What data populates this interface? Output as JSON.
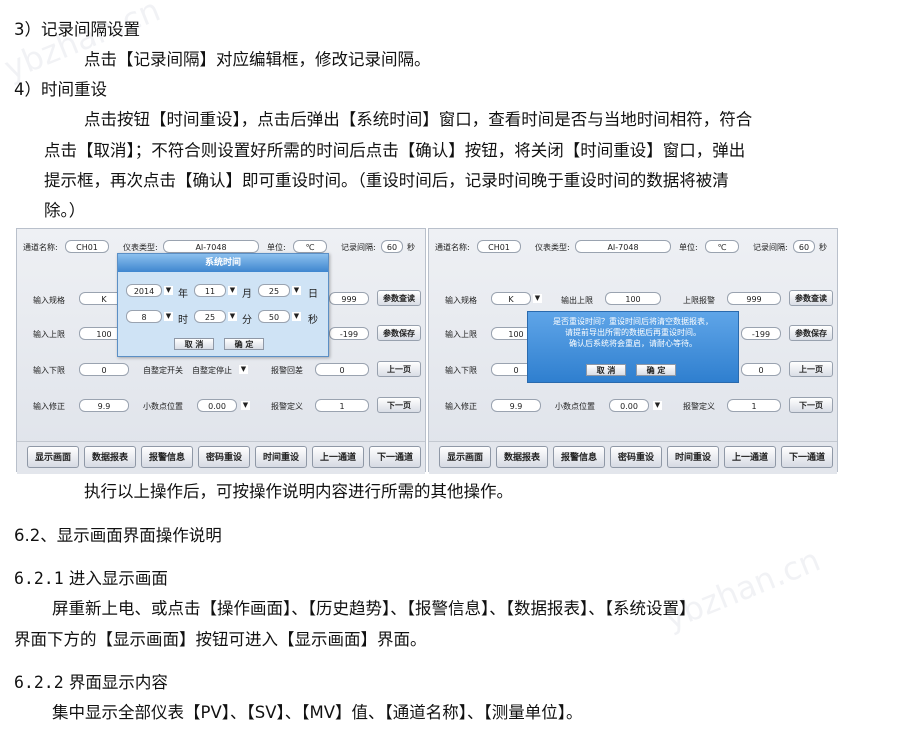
{
  "section_3": {
    "heading": "3）记录间隔设置",
    "body": "点击【记录间隔】对应编辑框，修改记录间隔。"
  },
  "section_4": {
    "heading": "4）时间重设",
    "line1": "点击按钮【时间重设】，点击后弹出【系统时间】窗口，查看时间是否与当地时间相符，符合",
    "line2": "点击【取消】；不符合则设置好所需的时间后点击【确认】按钮，将关闭【时间重设】窗口，弹出",
    "line3": "提示框，再次点击【确认】即可重设时间。（重设时间后，记录时间晚于重设时间的数据将被清",
    "line4": "除。）"
  },
  "screenshot": {
    "header": {
      "channel_name_label": "通道名称:",
      "channel_name_value": "CH01",
      "meter_type_label": "仪表类型:",
      "meter_type_value": "AI-7048",
      "unit_label": "单位:",
      "unit_value": "℃",
      "record_interval_label": "记录间隔:",
      "record_interval_value": "60",
      "record_interval_unit": "秒"
    },
    "fields": {
      "input_spec_label": "输入规格",
      "input_spec_value": "K",
      "output_upper_label": "输出上限",
      "output_upper_value": "100",
      "upper_alarm_label": "上限报警",
      "upper_alarm_value": "999",
      "input_upper_label": "输入上限",
      "input_upper_value": "100",
      "lower_alarm_value": "-199",
      "input_lower_label": "输入下限",
      "input_lower_value": "0",
      "self_tune_label": "自整定开关",
      "self_tune_value": "自整定停止",
      "alarm_return_label": "报警回差",
      "alarm_return_value": "0",
      "right_lower_value": "0",
      "input_correct_label": "输入修正",
      "input_correct_value": "9.9",
      "decimal_label": "小数点位置",
      "decimal_value": "0.00",
      "alarm_def_label": "报警定义",
      "alarm_def_value": "1"
    },
    "side_buttons": {
      "query_params": "参数查读",
      "save_params": "参数保存",
      "prev_page": "上一页",
      "next_page": "下一页"
    },
    "bottom_buttons": [
      "显示画面",
      "数据报表",
      "报警信息",
      "密码重设",
      "时间重设",
      "上一通道",
      "下一通道"
    ],
    "system_time_dialog": {
      "title": "系统时间",
      "year": "2014",
      "year_unit": "年",
      "month": "11",
      "month_unit": "月",
      "day": "25",
      "day_unit": "日",
      "hour": "8",
      "hour_unit": "时",
      "minute": "25",
      "minute_unit": "分",
      "second": "50",
      "second_unit": "秒",
      "cancel": "取 消",
      "confirm": "确 定"
    },
    "confirm_dialog": {
      "line1": "是否重设时间？重设时间后将清空数据报表，",
      "line2": "请提前导出所需的数据后再重设时间。",
      "line3": "确认后系统将会重启，请耐心等待。",
      "cancel": "取 消",
      "confirm": "确 定"
    },
    "dropdown_glyph": "▼"
  },
  "after_text": "执行以上操作后，可按操作说明内容进行所需的其他操作。",
  "section_6_2": {
    "heading": "6.2、显示画面界面操作说明"
  },
  "section_6_2_1": {
    "heading_num": "6.2.1",
    "heading_text": "进入显示画面",
    "line1": "屏重新上电、或点击【操作画面】、【历史趋势】、【报警信息】、【数据报表】、【系统设置】",
    "line2": "界面下方的【显示画面】按钮可进入【显示画面】界面。"
  },
  "section_6_2_2": {
    "heading_num": "6.2.2",
    "heading_text": "界面显示内容",
    "body": "集中显示全部仪表【PV】、【SV】、【MV】值、【通道名称】、【测量单位】。"
  },
  "watermark": "ybzhan.cn"
}
